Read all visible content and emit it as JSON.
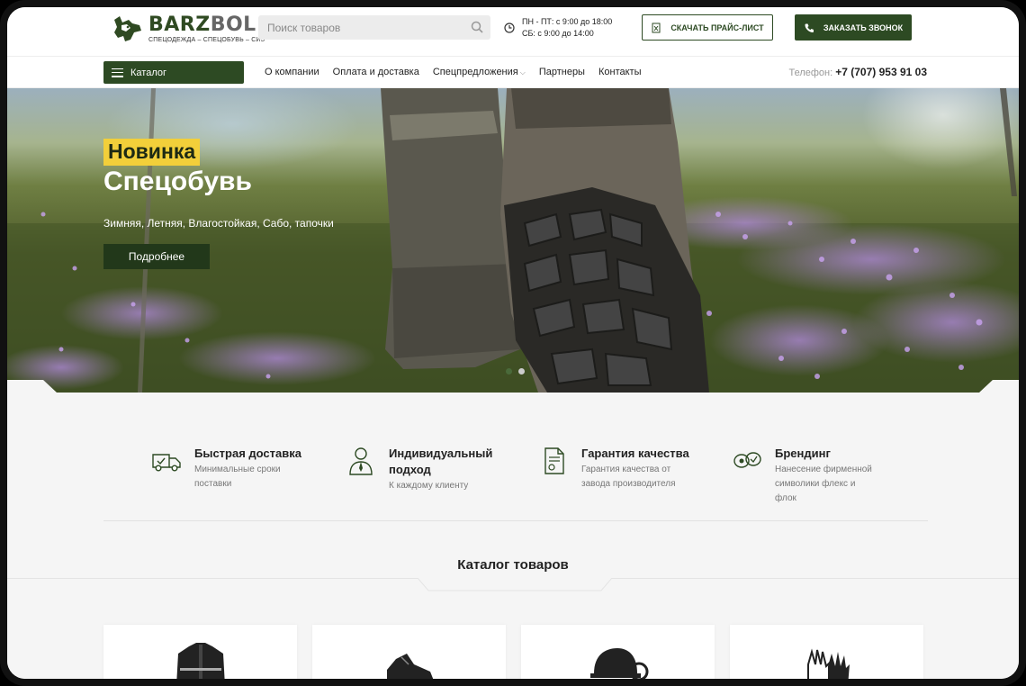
{
  "header": {
    "logo_name_a": "BARZ",
    "logo_name_b": "BOL",
    "logo_sub": "СПЕЦОДЕЖДА – СПЕЦОБУВЬ – СИЗ",
    "search_placeholder": "Поиск товаров",
    "hours_line1": "ПН - ПТ: с 9:00 до 18:00",
    "hours_line2": "СБ: с 9:00 до 14:00",
    "price_list_label": "СКАЧАТЬ ПРАЙС-ЛИСТ",
    "callback_label": "ЗАКАЗАТЬ ЗВОНОК"
  },
  "nav": {
    "catalog_label": "Каталог",
    "links": [
      "О компании",
      "Оплата и доставка",
      "Спецпредложения",
      "Партнеры",
      "Контакты"
    ],
    "phone_label": "Телефон:",
    "phone_number": "+7 (707) 953 91 03"
  },
  "hero": {
    "badge": "Новинка",
    "title": "Спецобувь",
    "subtitle": "Зимняя, Летняя, Влагостойкая, Сабо, тапочки",
    "button": "Подробнее",
    "slides_total": 2,
    "slide_active": 1
  },
  "features": [
    {
      "icon": "delivery-truck-icon",
      "title": "Быстрая доставка",
      "desc1": "Минимальные сроки",
      "desc2": "поставки",
      "desc3": ""
    },
    {
      "icon": "person-icon",
      "title1": "Индивидуальный",
      "title2": "подход",
      "desc1": "К каждому клиенту"
    },
    {
      "icon": "certificate-icon",
      "title": "Гарантия качества",
      "desc1": "Гарантия качества от",
      "desc2": "завода производителя"
    },
    {
      "icon": "branding-icon",
      "title": "Брендинг",
      "desc1": "Нанесение фирменной",
      "desc2": "символики флекс и",
      "desc3": "флок"
    }
  ],
  "catalog": {
    "title": "Каталог товаров",
    "cards": [
      "jacket-icon",
      "boot-icon",
      "helmet-icon",
      "gloves-icon"
    ]
  },
  "colors": {
    "brand_green": "#2d4a23",
    "badge_yellow": "#f2cf3a",
    "page_bg": "#f5f5f5"
  }
}
